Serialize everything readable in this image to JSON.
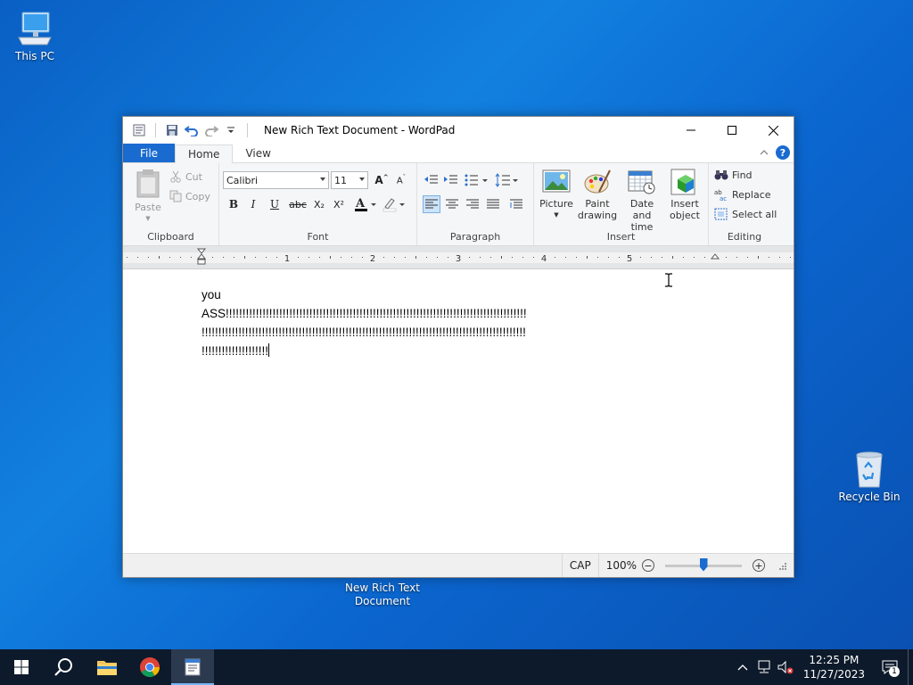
{
  "desktop": {
    "icons": [
      {
        "label": "This PC"
      },
      {
        "label": "Recycle Bin"
      },
      {
        "label": "New Rich Text Document"
      }
    ]
  },
  "window": {
    "title": "New Rich Text Document - WordPad",
    "tabs": {
      "file": "File",
      "home": "Home",
      "view": "View"
    },
    "ribbon": {
      "clipboard": {
        "label": "Clipboard",
        "paste": "Paste",
        "cut": "Cut",
        "copy": "Copy"
      },
      "font": {
        "label": "Font",
        "family": "Calibri",
        "size": "11",
        "bold": "B",
        "italic": "I",
        "underline": "U",
        "strike": "abc",
        "subscript": "X₂",
        "superscript": "X²"
      },
      "paragraph": {
        "label": "Paragraph"
      },
      "insert": {
        "label": "Insert",
        "picture": "Picture",
        "paint_line1": "Paint",
        "paint_line2": "drawing",
        "datetime_line1": "Date and",
        "datetime_line2": "time",
        "object_line1": "Insert",
        "object_line2": "object"
      },
      "editing": {
        "label": "Editing",
        "find": "Find",
        "replace": "Replace",
        "select_all": "Select all"
      }
    },
    "ruler": {
      "numbers": [
        "1",
        "2",
        "3",
        "4",
        "5"
      ]
    },
    "document": {
      "lines": [
        "you",
        "ASS!!!!!!!!!!!!!!!!!!!!!!!!!!!!!!!!!!!!!!!!!!!!!!!!!!!!!!!!!!!!!!!!!!!!!!!!!!!!!!!!!!!!!!!!!!",
        "!!!!!!!!!!!!!!!!!!!!!!!!!!!!!!!!!!!!!!!!!!!!!!!!!!!!!!!!!!!!!!!!!!!!!!!!!!!!!!!!!!!!!!!!!!!!!!!!!",
        "!!!!!!!!!!!!!!!!!!!!"
      ]
    },
    "statusbar": {
      "caps": "CAP",
      "zoom": "100%",
      "zoom_level": 0.5
    }
  },
  "taskbar": {
    "clock_time": "12:25 PM",
    "clock_date": "11/27/2023",
    "notification_count": "1"
  }
}
